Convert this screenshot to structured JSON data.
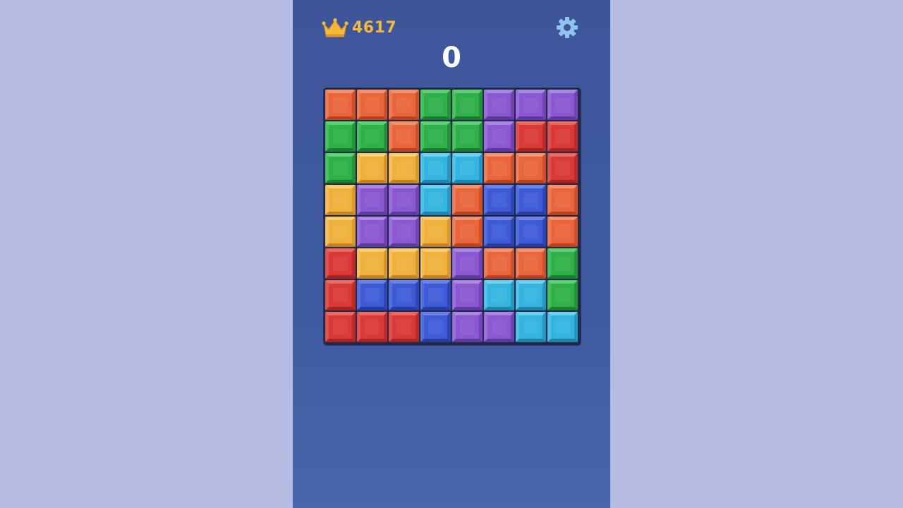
{
  "header": {
    "best_score": "4617",
    "best_icon": "crown-icon",
    "settings_icon": "gear-icon"
  },
  "score": "0",
  "colors": {
    "background": "#b5bbe1",
    "panel": "#3e559a",
    "best_score_text": "#f5b93a",
    "settings_icon": "#8fc4ef",
    "board_frame": "#1f2a4a",
    "orange": "#e9663c",
    "green": "#2fb04a",
    "purple": "#8a58d0",
    "red": "#d93a36",
    "yellow": "#f0b13c",
    "cyan": "#34b5df",
    "blue": "#3e5bd6"
  },
  "board": {
    "rows": [
      [
        "orange",
        "orange",
        "orange",
        "green",
        "green",
        "purple",
        "purple",
        "purple"
      ],
      [
        "green",
        "green",
        "orange",
        "green",
        "green",
        "purple",
        "red",
        "red"
      ],
      [
        "green",
        "yellow",
        "yellow",
        "cyan",
        "cyan",
        "orange",
        "orange",
        "red"
      ],
      [
        "yellow",
        "purple",
        "purple",
        "cyan",
        "orange",
        "blue",
        "blue",
        "orange"
      ],
      [
        "yellow",
        "purple",
        "purple",
        "yellow",
        "orange",
        "blue",
        "blue",
        "orange"
      ],
      [
        "red",
        "yellow",
        "yellow",
        "yellow",
        "purple",
        "orange",
        "orange",
        "green"
      ],
      [
        "red",
        "blue",
        "blue",
        "blue",
        "purple",
        "cyan",
        "cyan",
        "green"
      ],
      [
        "red",
        "red",
        "red",
        "blue",
        "purple",
        "purple",
        "cyan",
        "cyan"
      ]
    ]
  }
}
